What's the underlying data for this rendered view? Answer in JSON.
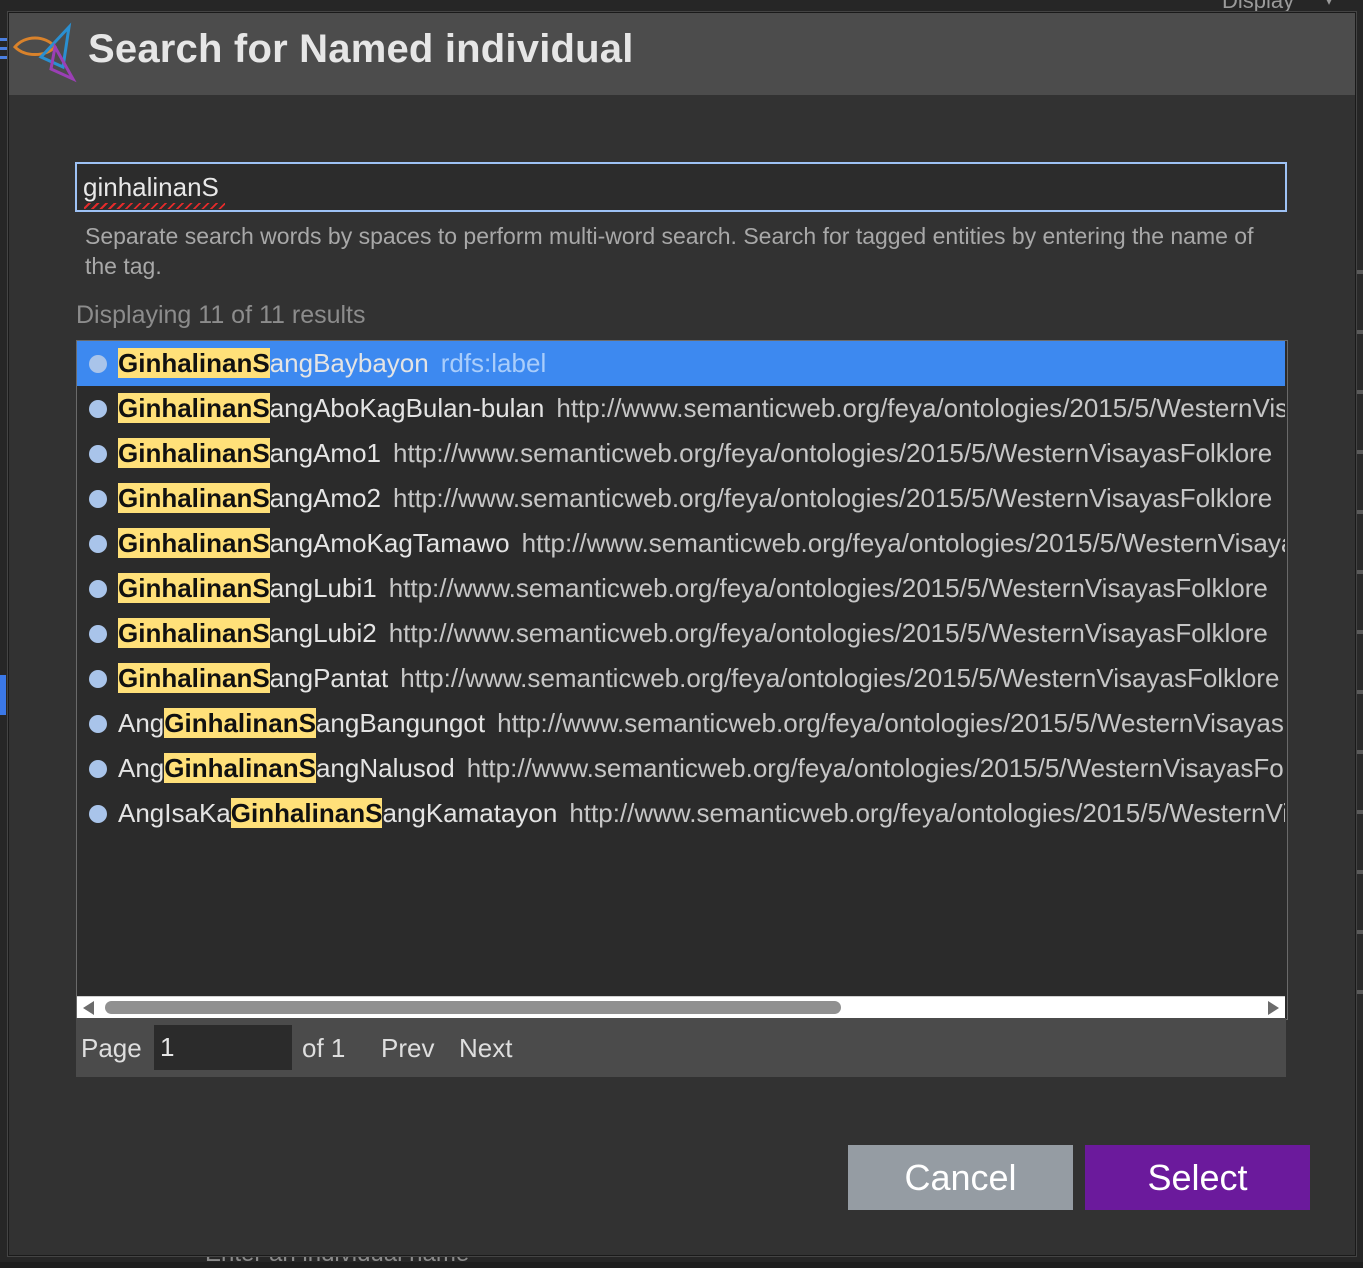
{
  "background": {
    "display_label": "Display",
    "bottom_text": "Enter an individual name"
  },
  "dialog": {
    "title": "Search for Named individual",
    "search": {
      "value": "ginhalinanS",
      "help_text": "Separate search words by spaces to perform multi-word search. Search for tagged entities by entering the name of the tag."
    },
    "results_count": "Displaying 11 of 11 results",
    "results": [
      {
        "prefix": "",
        "match": "GinhalinanS",
        "suffix": "angBaybayon",
        "detail": "rdfs:label",
        "selected": true
      },
      {
        "prefix": "",
        "match": "GinhalinanS",
        "suffix": "angAboKagBulan-bulan",
        "detail": "http://www.semanticweb.org/feya/ontologies/2015/5/WesternVisayasFolklore"
      },
      {
        "prefix": "",
        "match": "GinhalinanS",
        "suffix": "angAmo1",
        "detail": "http://www.semanticweb.org/feya/ontologies/2015/5/WesternVisayasFolklore"
      },
      {
        "prefix": "",
        "match": "GinhalinanS",
        "suffix": "angAmo2",
        "detail": "http://www.semanticweb.org/feya/ontologies/2015/5/WesternVisayasFolklore"
      },
      {
        "prefix": "",
        "match": "GinhalinanS",
        "suffix": "angAmoKagTamawo",
        "detail": "http://www.semanticweb.org/feya/ontologies/2015/5/WesternVisayasFolklore"
      },
      {
        "prefix": "",
        "match": "GinhalinanS",
        "suffix": "angLubi1",
        "detail": "http://www.semanticweb.org/feya/ontologies/2015/5/WesternVisayasFolklore"
      },
      {
        "prefix": "",
        "match": "GinhalinanS",
        "suffix": "angLubi2",
        "detail": "http://www.semanticweb.org/feya/ontologies/2015/5/WesternVisayasFolklore"
      },
      {
        "prefix": "",
        "match": "GinhalinanS",
        "suffix": "angPantat",
        "detail": "http://www.semanticweb.org/feya/ontologies/2015/5/WesternVisayasFolklore"
      },
      {
        "prefix": "Ang",
        "match": "GinhalinanS",
        "suffix": "angBangungot",
        "detail": "http://www.semanticweb.org/feya/ontologies/2015/5/WesternVisayasFolklore"
      },
      {
        "prefix": "Ang",
        "match": "GinhalinanS",
        "suffix": "angNalusod",
        "detail": "http://www.semanticweb.org/feya/ontologies/2015/5/WesternVisayasFolklore"
      },
      {
        "prefix": "AngIsaKa",
        "match": "GinhalinanS",
        "suffix": "angKamatayon",
        "detail": "http://www.semanticweb.org/feya/ontologies/2015/5/WesternVisayasFolklore"
      }
    ],
    "pager": {
      "page_label": "Page",
      "page_value": "1",
      "of_label": "of 1",
      "prev_label": "Prev",
      "next_label": "Next"
    },
    "buttons": {
      "cancel_label": "Cancel",
      "select_label": "Select"
    }
  },
  "colors": {
    "selected_row": "#3d89f0",
    "highlight": "#ffe079",
    "select_button": "#6b1a9c",
    "cancel_button": "#959ca3"
  }
}
